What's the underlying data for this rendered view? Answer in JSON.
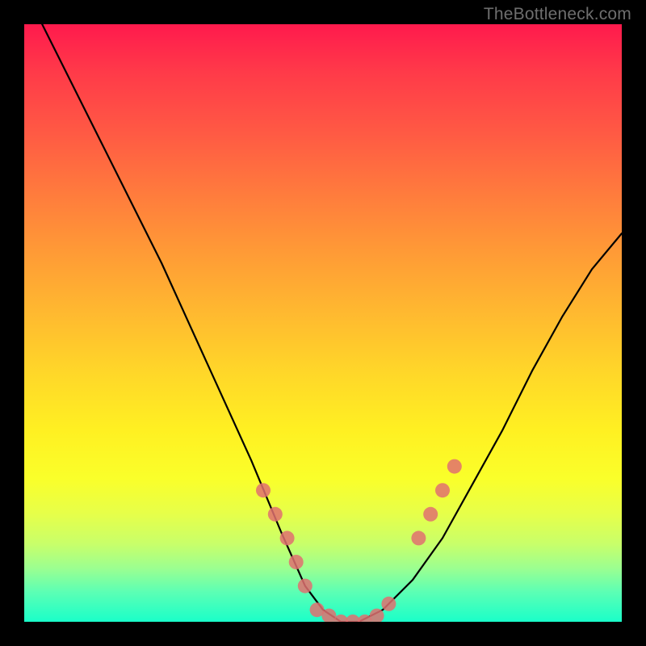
{
  "watermark": "TheBottleneck.com",
  "chart_data": {
    "type": "line",
    "title": "",
    "xlabel": "",
    "ylabel": "",
    "xlim": [
      0,
      1
    ],
    "ylim": [
      0,
      1
    ],
    "series": [
      {
        "name": "bottleneck-curve",
        "color": "#000000",
        "x": [
          0.03,
          0.08,
          0.13,
          0.18,
          0.23,
          0.28,
          0.33,
          0.38,
          0.43,
          0.47,
          0.5,
          0.53,
          0.56,
          0.6,
          0.65,
          0.7,
          0.75,
          0.8,
          0.85,
          0.9,
          0.95,
          1.0
        ],
        "y": [
          1.0,
          0.9,
          0.8,
          0.7,
          0.6,
          0.49,
          0.38,
          0.27,
          0.15,
          0.06,
          0.02,
          0.0,
          0.0,
          0.02,
          0.07,
          0.14,
          0.23,
          0.32,
          0.42,
          0.51,
          0.59,
          0.65
        ]
      },
      {
        "name": "highlight-dots-left",
        "color": "#e17070",
        "type": "scatter",
        "x": [
          0.4,
          0.42,
          0.44,
          0.455,
          0.47
        ],
        "y": [
          0.22,
          0.18,
          0.14,
          0.1,
          0.06
        ]
      },
      {
        "name": "highlight-dots-bottom",
        "color": "#e17070",
        "type": "scatter",
        "x": [
          0.49,
          0.51,
          0.53,
          0.55,
          0.57,
          0.59,
          0.61
        ],
        "y": [
          0.02,
          0.01,
          0.0,
          0.0,
          0.0,
          0.01,
          0.03
        ]
      },
      {
        "name": "highlight-dots-right",
        "color": "#e17070",
        "type": "scatter",
        "x": [
          0.66,
          0.68,
          0.7,
          0.72
        ],
        "y": [
          0.14,
          0.18,
          0.22,
          0.26
        ]
      }
    ],
    "background_gradient": {
      "top_color": "#ff1a4d",
      "bottom_color": "#1affc9",
      "description": "red-to-green vertical gradient (high=bad, low=good)"
    }
  }
}
